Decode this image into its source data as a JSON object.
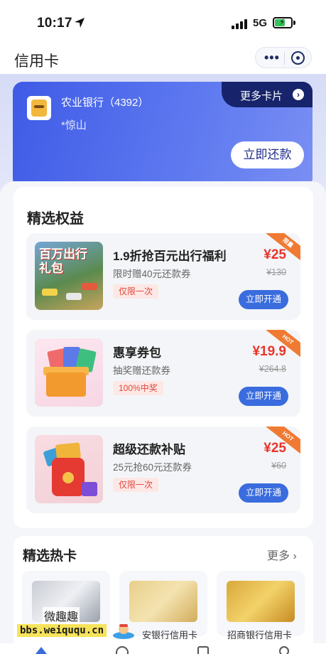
{
  "status_bar": {
    "time": "10:17",
    "network": "5G"
  },
  "nav": {
    "title": "信用卡",
    "more_icon": "ellipsis-icon",
    "close_icon": "mini-program-close-icon"
  },
  "card_banner": {
    "bank_name": "农业银行（4392）",
    "holder_name": "*惊山",
    "more_cards_label": "更多卡片",
    "repay_button": "立即还款"
  },
  "benefits": {
    "title": "精选权益",
    "items": [
      {
        "title": "1.9折抢百元出行福利",
        "subtitle": "限时赠40元还款券",
        "tag": "仅限一次",
        "price": "¥25",
        "original_price": "¥130",
        "button": "立即开通",
        "badge": "限量",
        "thumb_text": "百万出行礼包"
      },
      {
        "title": "惠享券包",
        "subtitle": "抽奖赠还款券",
        "tag": "100%中奖",
        "price": "¥19.9",
        "original_price": "¥264.8",
        "button": "立即开通",
        "badge": "HOT"
      },
      {
        "title": "超级还款补贴",
        "subtitle": "25元抢60元还款券",
        "tag": "仅限一次",
        "price": "¥25",
        "original_price": "¥60",
        "button": "立即开通",
        "badge": "HOT"
      }
    ]
  },
  "hot_cards": {
    "title": "精选热卡",
    "more": "更多",
    "cards": [
      {
        "label": ""
      },
      {
        "label": "安银行信用卡"
      },
      {
        "label": "招商银行信用卡"
      }
    ]
  },
  "watermark": {
    "title": "微趣趣",
    "url": "bbs.weiququ.cn"
  },
  "colors": {
    "brand_blue": "#3f5be6",
    "navy": "#17246b",
    "price_red": "#e8352a",
    "button_blue": "#3a6cde",
    "badge_orange": "#f07a32"
  }
}
